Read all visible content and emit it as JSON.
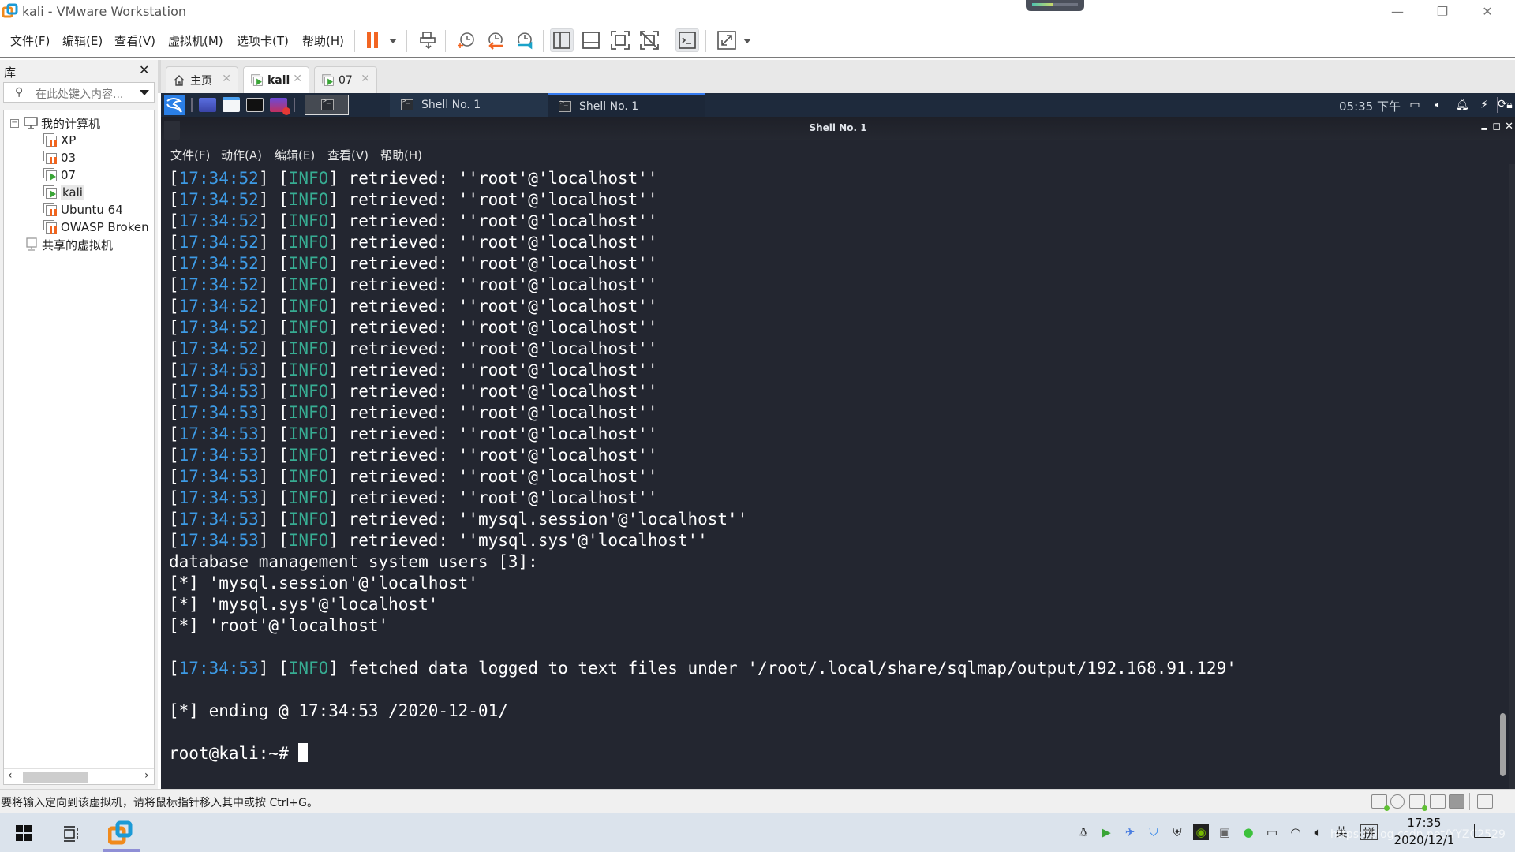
{
  "window": {
    "title": "kali - VMware Workstation",
    "controls": {
      "minimize": "—",
      "restore": "❐",
      "close": "✕"
    }
  },
  "menu": [
    "文件(F)",
    "编辑(E)",
    "查看(V)",
    "虚拟机(M)",
    "选项卡(T)",
    "帮助(H)"
  ],
  "toolbar": {
    "icons": [
      "pause-icon",
      "send-ctrl-alt-del-icon",
      "snapshot-take-icon",
      "snapshot-revert-icon",
      "snapshot-manager-icon",
      "show-library-icon",
      "show-thumbnails-icon",
      "fullscreen-icon",
      "unity-icon",
      "console-view-icon",
      "stretch-guest-icon"
    ]
  },
  "library": {
    "title": "库",
    "close": "✕",
    "search_placeholder": "在此处键入内容...",
    "tree": {
      "root": "我的计算机",
      "vms": [
        {
          "name": "XP",
          "state": "suspended"
        },
        {
          "name": "03",
          "state": "suspended"
        },
        {
          "name": "07",
          "state": "running"
        },
        {
          "name": "kali",
          "state": "running",
          "selected": true
        },
        {
          "name": "Ubuntu 64",
          "state": "suspended"
        },
        {
          "name": "OWASP Broken",
          "state": "suspended"
        }
      ],
      "shared": "共享的虚拟机"
    }
  },
  "tabs": [
    {
      "label": "主页",
      "icon": "home-icon",
      "active": false
    },
    {
      "label": "kali",
      "icon": "vm-running-icon",
      "active": true
    },
    {
      "label": "07",
      "icon": "vm-running-icon",
      "active": false
    }
  ],
  "guest_panel": {
    "tasks": [
      "Shell No. 1",
      "Shell No. 1"
    ],
    "active_task": 1,
    "clock": "05:35 下午"
  },
  "terminal": {
    "title": "Shell No. 1",
    "menu": [
      "文件(F)",
      "动作(A)",
      "编辑(E)",
      "查看(V)",
      "帮助(H)"
    ],
    "log_lines": [
      {
        "ts": "17:34:52",
        "level": "INFO",
        "msg": "retrieved: ''root'@'localhost''"
      },
      {
        "ts": "17:34:52",
        "level": "INFO",
        "msg": "retrieved: ''root'@'localhost''"
      },
      {
        "ts": "17:34:52",
        "level": "INFO",
        "msg": "retrieved: ''root'@'localhost''"
      },
      {
        "ts": "17:34:52",
        "level": "INFO",
        "msg": "retrieved: ''root'@'localhost''"
      },
      {
        "ts": "17:34:52",
        "level": "INFO",
        "msg": "retrieved: ''root'@'localhost''"
      },
      {
        "ts": "17:34:52",
        "level": "INFO",
        "msg": "retrieved: ''root'@'localhost''"
      },
      {
        "ts": "17:34:52",
        "level": "INFO",
        "msg": "retrieved: ''root'@'localhost''"
      },
      {
        "ts": "17:34:52",
        "level": "INFO",
        "msg": "retrieved: ''root'@'localhost''"
      },
      {
        "ts": "17:34:52",
        "level": "INFO",
        "msg": "retrieved: ''root'@'localhost''"
      },
      {
        "ts": "17:34:53",
        "level": "INFO",
        "msg": "retrieved: ''root'@'localhost''"
      },
      {
        "ts": "17:34:53",
        "level": "INFO",
        "msg": "retrieved: ''root'@'localhost''"
      },
      {
        "ts": "17:34:53",
        "level": "INFO",
        "msg": "retrieved: ''root'@'localhost''"
      },
      {
        "ts": "17:34:53",
        "level": "INFO",
        "msg": "retrieved: ''root'@'localhost''"
      },
      {
        "ts": "17:34:53",
        "level": "INFO",
        "msg": "retrieved: ''root'@'localhost''"
      },
      {
        "ts": "17:34:53",
        "level": "INFO",
        "msg": "retrieved: ''root'@'localhost''"
      },
      {
        "ts": "17:34:53",
        "level": "INFO",
        "msg": "retrieved: ''root'@'localhost''"
      },
      {
        "ts": "17:34:53",
        "level": "INFO",
        "msg": "retrieved: ''mysql.session'@'localhost''"
      },
      {
        "ts": "17:34:53",
        "level": "INFO",
        "msg": "retrieved: ''mysql.sys'@'localhost''"
      }
    ],
    "summary_header": "database management system users [3]:",
    "users": [
      "[*] 'mysql.session'@'localhost'",
      "[*] 'mysql.sys'@'localhost'",
      "[*] 'root'@'localhost'"
    ],
    "fetched_line": {
      "ts": "17:34:53",
      "level": "INFO",
      "msg": "fetched data logged to text files under '/root/.local/share/sqlmap/output/192.168.91.129'"
    },
    "ending_line": "[*] ending @ 17:34:53 /2020-12-01/",
    "prompt": "root@kali:~# "
  },
  "statusbar": {
    "message": "要将输入定向到该虚拟机，请将鼠标指针移入其中或按 Ctrl+G。"
  },
  "taskbar": {
    "time": "17:35",
    "date": "2020/12/1",
    "ime_lang": "英",
    "ime_mode": "拼",
    "watermark": "https://blog.csdn.net/YYZC2529"
  },
  "colors": {
    "timestamp": "#3d9be6",
    "info": "#37ad93",
    "terminal_bg": "#232630",
    "guest_panel_bg": "#1e2a3c",
    "active_task_accent": "#367bf0",
    "pause_orange": "#f26522"
  }
}
